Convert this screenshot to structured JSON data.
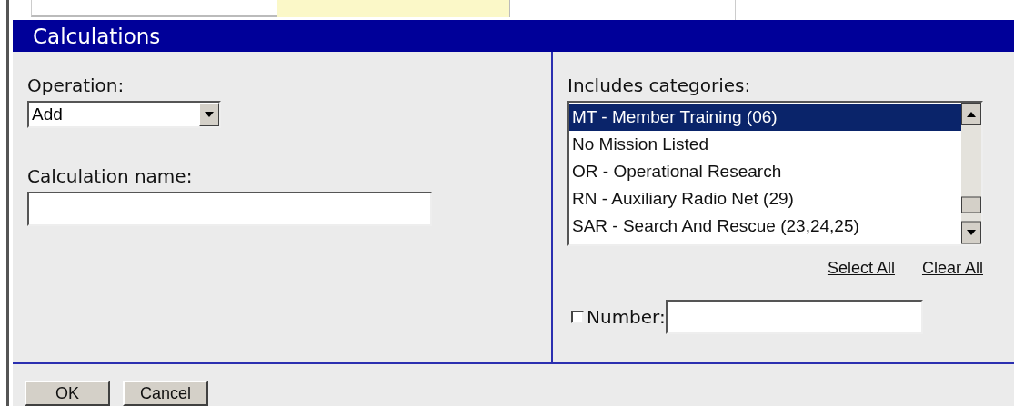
{
  "panel": {
    "title": "Calculations"
  },
  "operation": {
    "label": "Operation:",
    "value": "Add"
  },
  "calculation_name": {
    "label": "Calculation name:"
  },
  "categories": {
    "label": "Includes categories:",
    "items": [
      {
        "label": "MT - Member Training (06)",
        "selected": true
      },
      {
        "label": "No Mission Listed",
        "selected": false
      },
      {
        "label": "OR - Operational Research",
        "selected": false
      },
      {
        "label": "RN - Auxiliary Radio Net (29)",
        "selected": false
      },
      {
        "label": "SAR - Search And Rescue (23,24,25)",
        "selected": false
      }
    ],
    "links": [
      "Select All",
      "Clear All"
    ]
  },
  "number": {
    "label": "Number:",
    "checked": false
  },
  "buttons": [
    "OK",
    "Cancel"
  ]
}
